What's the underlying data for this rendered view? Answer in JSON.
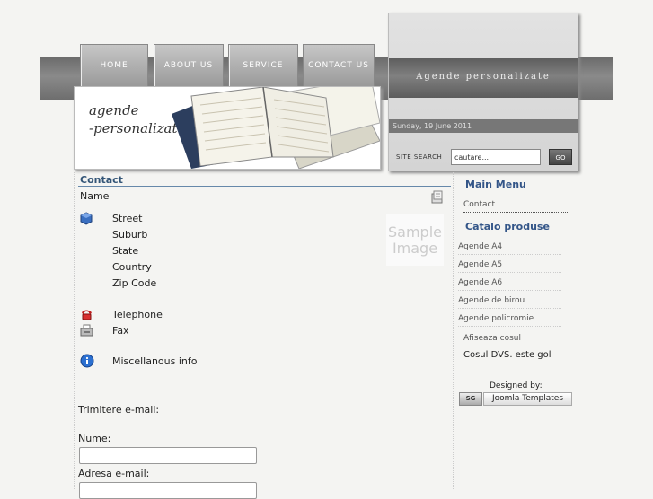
{
  "nav": {
    "home": "HOME",
    "about": "ABOUT US",
    "service": "SERVICE",
    "contact": "CONTACT US"
  },
  "banner": {
    "logo_line1": "agende",
    "logo_line2": "-personalizate"
  },
  "header": {
    "site_title": "Agende personalizate",
    "date": "Sunday, 19 June 2011",
    "search_label": "SITE SEARCH",
    "search_value": "cautare...",
    "go_label": "GO"
  },
  "contact": {
    "heading": "Contact",
    "name_label": "Name",
    "street": "Street",
    "suburb": "Suburb",
    "state": "State",
    "country": "Country",
    "zip": "Zip Code",
    "telephone": "Telephone",
    "fax": "Fax",
    "misc": "Miscellanous info",
    "sample_line1": "Sample",
    "sample_line2": "Image",
    "email_heading": "Trimitere e-mail:",
    "name_field_label": "Nume:",
    "email_field_label": "Adresa e-mail:"
  },
  "sidebar": {
    "main_menu": "Main Menu",
    "contact_link": "Contact",
    "catalog_heading": "Catalo produse",
    "items": [
      "Agende A4",
      "Agende A5",
      "Agende A6",
      "Agende de birou",
      "Agende policromie"
    ],
    "cart_link": "Afiseaza cosul",
    "cart_status": "Cosul DVS. este gol",
    "designed_by": "Designed by:",
    "badge": "SG",
    "joomla": "Joomla Templates"
  }
}
